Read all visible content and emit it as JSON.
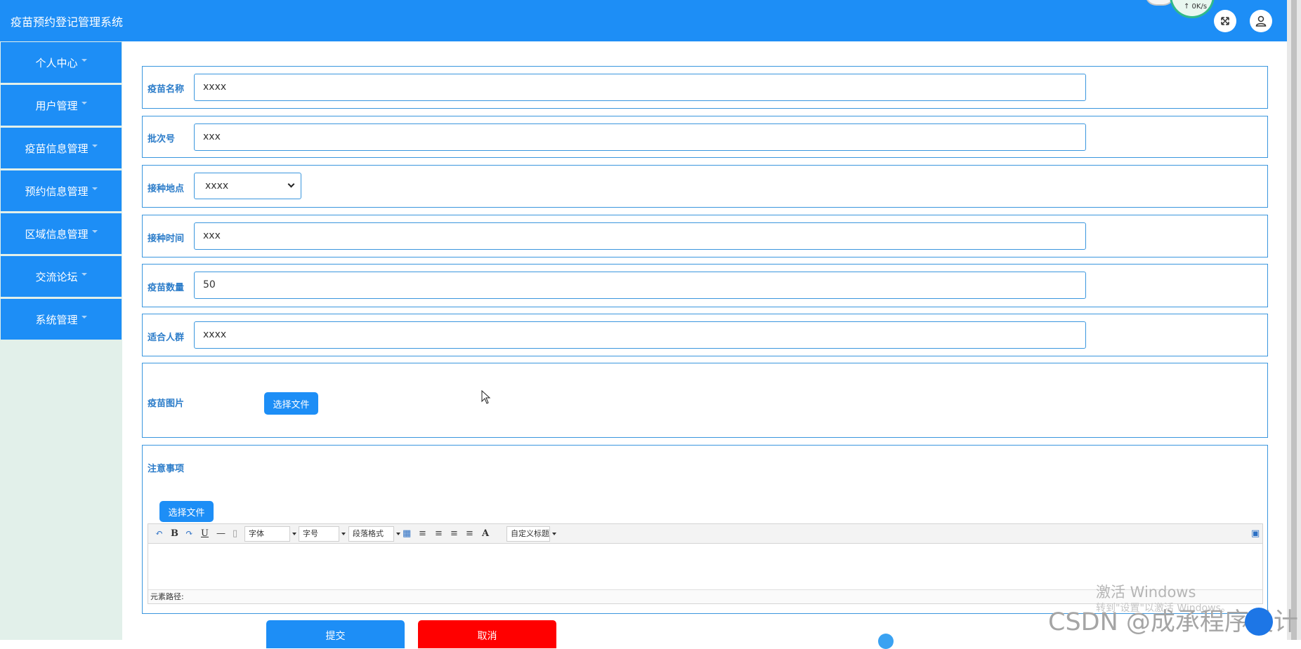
{
  "app": {
    "title": "疫苗预约登记管理系统"
  },
  "topbar": {
    "net_speed": "↑ 0K/s"
  },
  "sidebar": {
    "items": [
      {
        "label": "个人中心"
      },
      {
        "label": "用户管理"
      },
      {
        "label": "疫苗信息管理"
      },
      {
        "label": "预约信息管理"
      },
      {
        "label": "区域信息管理"
      },
      {
        "label": "交流论坛"
      },
      {
        "label": "系统管理"
      }
    ]
  },
  "form": {
    "vaccine_name": {
      "label": "疫苗名称",
      "value": "xxxx"
    },
    "batch_no": {
      "label": "批次号",
      "value": "xxx"
    },
    "location": {
      "label": "接种地点",
      "value": "xxxx"
    },
    "time": {
      "label": "接种时间",
      "value": "xxx"
    },
    "quantity": {
      "label": "疫苗数量",
      "value": "50"
    },
    "population": {
      "label": "适合人群",
      "value": "xxxx"
    },
    "image": {
      "label": "疫苗图片",
      "button": "选择文件"
    },
    "notes": {
      "label": "注意事项",
      "button": "选择文件"
    }
  },
  "editor": {
    "font": "字体",
    "size": "字号",
    "paragraph": "段落格式",
    "custom_title": "自定义标题",
    "path_label": "元素路径:",
    "bold": "B",
    "underline": "U",
    "font_color": "A"
  },
  "actions": {
    "submit": "提交",
    "cancel": "取消"
  },
  "watermark": {
    "windows_line1": "激活 Windows",
    "windows_line2": "转到\"设置\"以激活 Windows。",
    "csdn": "CSDN @成承程序设计"
  },
  "colors": {
    "primary": "#1d8ef6",
    "cancel": "#ff0000",
    "sidebar_bg": "#e2f0ea",
    "label": "#2b7cc9"
  }
}
